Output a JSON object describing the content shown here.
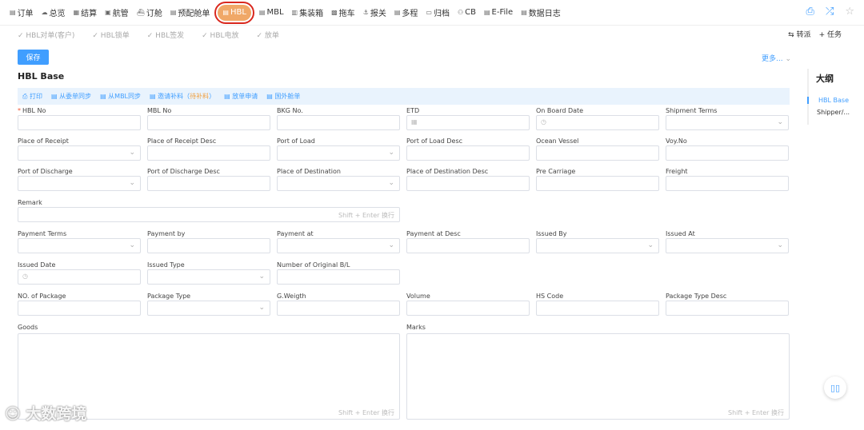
{
  "topnav": [
    {
      "label": "订单",
      "icon": "doc-icon"
    },
    {
      "label": "总览",
      "icon": "cloud-icon"
    },
    {
      "label": "结算",
      "icon": "calc-icon"
    },
    {
      "label": "航管",
      "icon": "ship-icon"
    },
    {
      "label": "订舱",
      "icon": "boat-icon"
    },
    {
      "label": "预配舱单",
      "icon": "manifest-icon"
    },
    {
      "label": "HBL",
      "icon": "hbl-icon",
      "active": true
    },
    {
      "label": "MBL",
      "icon": "mbl-icon"
    },
    {
      "label": "集装箱",
      "icon": "container-icon"
    },
    {
      "label": "拖车",
      "icon": "truck-icon"
    },
    {
      "label": "报关",
      "icon": "anchor-icon"
    },
    {
      "label": "多程",
      "icon": "route-icon"
    },
    {
      "label": "归档",
      "icon": "archive-icon"
    },
    {
      "label": "CB",
      "icon": "person-icon"
    },
    {
      "label": "E-File",
      "icon": "efile-icon"
    },
    {
      "label": "数据日志",
      "icon": "log-icon"
    }
  ],
  "subnav": [
    "HBL对单(客户)",
    "HBL锁单",
    "HBL签发",
    "HBL电放",
    "放单"
  ],
  "subnav_right": {
    "transfer": "转派",
    "task": "任务"
  },
  "save_label": "保存",
  "more_label": "更多...",
  "section_title": "HBL Base",
  "toolbar": {
    "print": "打印",
    "sync_order": "从委单同步",
    "sync_mbl": "从MBL同步",
    "invite_prefix": "邀请补料（",
    "invite_status": "待补料",
    "invite_suffix": "）",
    "release": "放单申请",
    "foreign": "国外舱单"
  },
  "outline": {
    "title": "大纲",
    "items": [
      "HBL Base",
      "Shipper/..."
    ]
  },
  "fields": {
    "hbl_no": "HBL No",
    "mbl_no": "MBL No",
    "bkg_no": "BKG No.",
    "etd": "ETD",
    "on_board_date": "On Board Date",
    "shipment_terms": "Shipment Terms",
    "place_of_receipt": "Place of Receipt",
    "place_of_receipt_desc": "Place of Receipt Desc",
    "port_of_load": "Port of Load",
    "port_of_load_desc": "Port of Load Desc",
    "ocean_vessel": "Ocean Vessel",
    "voy_no": "Voy.No",
    "port_of_discharge": "Port of Discharge",
    "port_of_discharge_desc": "Port of Discharge Desc",
    "place_of_destination": "Place of Destination",
    "place_of_destination_desc": "Place of Destination Desc",
    "pre_carriage": "Pre Carriage",
    "freight": "Freight",
    "remark": "Remark",
    "payment_terms": "Payment Terms",
    "payment_by": "Payment by",
    "payment_at": "Payment at",
    "payment_at_desc": "Payment at Desc",
    "issued_by": "Issued By",
    "issued_at": "Issued At",
    "issued_date": "Issued Date",
    "issued_type": "Issued Type",
    "num_original_bl": "Number of Original B/L",
    "no_of_package": "NO. of Package",
    "package_type": "Package Type",
    "g_weigth": "G.Weigth",
    "volume": "Volume",
    "hs_code": "HS Code",
    "package_type_desc": "Package Type Desc",
    "goods": "Goods",
    "marks": "Marks"
  },
  "textarea_hint": "Shift + Enter 换行",
  "watermark": "大数跨境"
}
